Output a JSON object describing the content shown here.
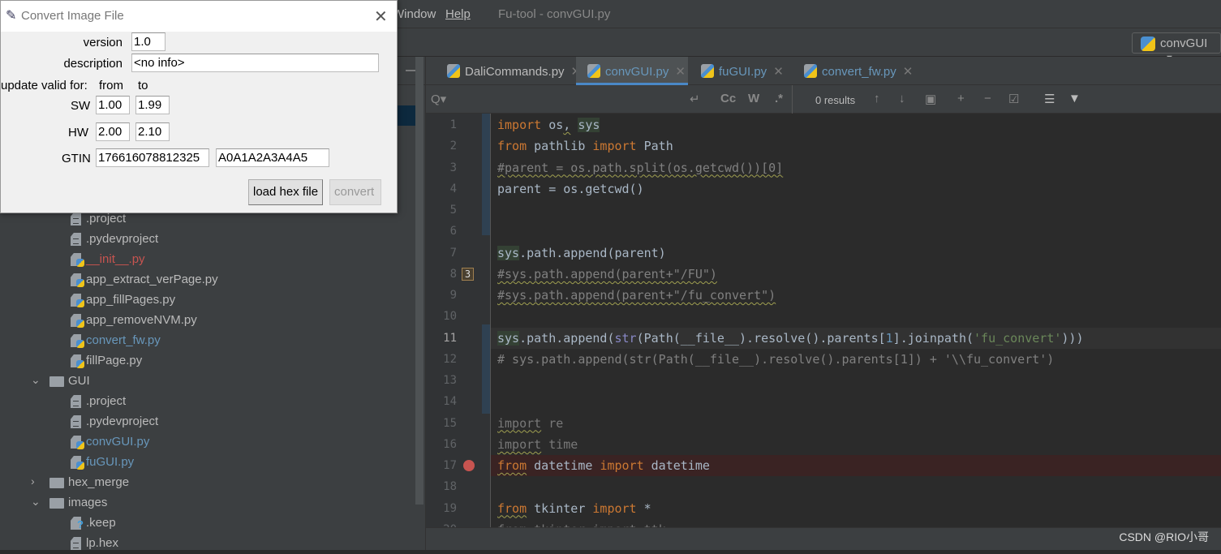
{
  "menubar": {
    "items": [
      "Window",
      "Help"
    ],
    "title": "Fu-tool - convGUI.py"
  },
  "toolbar": {
    "run_config": "convGUI"
  },
  "editor_tabs": [
    {
      "label": "DaliCommands.py",
      "active": false
    },
    {
      "label": "convGUI.py",
      "active": true
    },
    {
      "label": "fuGUI.py",
      "active": false
    },
    {
      "label": "convert_fw.py",
      "active": false
    }
  ],
  "search": {
    "results": "0 results",
    "match_case": "Cc",
    "words": "W",
    "regex": ".*"
  },
  "tree": [
    {
      "label": ".project",
      "type": "text",
      "level": 2
    },
    {
      "label": ".pydevproject",
      "type": "text",
      "level": 2
    },
    {
      "label": "__init__.py",
      "type": "py",
      "level": 2,
      "color": "#c75450"
    },
    {
      "label": "app_extract_verPage.py",
      "type": "py",
      "level": 2
    },
    {
      "label": "app_fillPages.py",
      "type": "py",
      "level": 2
    },
    {
      "label": "app_removeNVM.py",
      "type": "py",
      "level": 2
    },
    {
      "label": "convert_fw.py",
      "type": "py",
      "level": 2,
      "color": "#6897bb"
    },
    {
      "label": "fillPage.py",
      "type": "py",
      "level": 2
    },
    {
      "label": "GUI",
      "type": "folder",
      "level": 1,
      "expanded": true
    },
    {
      "label": ".project",
      "type": "text",
      "level": 2
    },
    {
      "label": ".pydevproject",
      "type": "text",
      "level": 2
    },
    {
      "label": "convGUI.py",
      "type": "py",
      "level": 2,
      "color": "#6897bb"
    },
    {
      "label": "fuGUI.py",
      "type": "py",
      "level": 2,
      "color": "#6897bb"
    },
    {
      "label": "hex_merge",
      "type": "folder",
      "level": 1,
      "expanded": false
    },
    {
      "label": "images",
      "type": "folder",
      "level": 1,
      "expanded": true
    },
    {
      "label": ".keep",
      "type": "unknown",
      "level": 2
    },
    {
      "label": "lp.hex",
      "type": "text",
      "level": 2
    }
  ],
  "code": {
    "current_line": 11,
    "breakpoint_line": 17,
    "fold_badge": {
      "line": 8,
      "text": "3"
    },
    "lines": [
      [
        [
          "import",
          "kw"
        ],
        [
          " os",
          ""
        ],
        [
          ",",
          "wav"
        ],
        [
          " ",
          ""
        ],
        [
          "sys",
          "sel"
        ]
      ],
      [
        [
          "from",
          "kw"
        ],
        [
          " pathlib ",
          ""
        ],
        [
          "import",
          "kw"
        ],
        [
          " Path",
          ""
        ]
      ],
      [
        [
          "#parent = os.path.split(os.getcwd())[0]",
          "cm wav"
        ]
      ],
      [
        [
          "parent = os.getcwd()",
          ""
        ]
      ],
      [],
      [],
      [
        [
          "sys",
          "sel"
        ],
        [
          ".path.append(parent)",
          ""
        ]
      ],
      [
        [
          "#sys.path.append(parent+\"/FU\")",
          "cm wav"
        ]
      ],
      [
        [
          "#sys.path.append(parent+\"/fu_convert\")",
          "cm wav"
        ]
      ],
      [],
      [
        [
          "sys",
          "sel"
        ],
        [
          ".path.append(",
          ""
        ],
        [
          "str",
          "bi"
        ],
        [
          "(Path(__file__).resolve().parents[",
          ""
        ],
        [
          "1",
          "num"
        ],
        [
          "].joinpath(",
          ""
        ],
        [
          "'fu_convert'",
          "st"
        ],
        [
          ")))",
          ""
        ]
      ],
      [
        [
          "# sys.path.append(str(Path(__file__).resolve().parents[1]) + '\\\\fu_convert')",
          "cm"
        ]
      ],
      [],
      [],
      [
        [
          "import",
          "dim wav"
        ],
        [
          " re",
          "dim"
        ]
      ],
      [
        [
          "import",
          "dim wav"
        ],
        [
          " time",
          "dim"
        ]
      ],
      [
        [
          "from",
          "kw wav"
        ],
        [
          " datetime ",
          ""
        ],
        [
          "import",
          "kw"
        ],
        [
          " datetime",
          ""
        ]
      ],
      [],
      [
        [
          "from",
          "kw wav"
        ],
        [
          " tkinter ",
          ""
        ],
        [
          "import",
          "kw"
        ],
        [
          " *",
          ""
        ]
      ],
      [
        [
          "from tkinter import ttk",
          "dim"
        ]
      ]
    ]
  },
  "dialog": {
    "title": "Convert Image File",
    "version_label": "version",
    "version": "1.0",
    "description_label": "description",
    "description": "<no info>",
    "update_label": "update valid for:",
    "from_label": "from",
    "to_label": "to",
    "sw_label": "SW",
    "sw_from": "1.00",
    "sw_to": "1.99",
    "hw_label": "HW",
    "hw_from": "2.00",
    "hw_to": "2.10",
    "gtin_label": "GTIN",
    "gtin": "176616078812325",
    "gtin2": "A0A1A2A3A4A5",
    "load_button": "load hex file",
    "convert_button": "convert"
  },
  "watermark": "CSDN @RIO小哥"
}
